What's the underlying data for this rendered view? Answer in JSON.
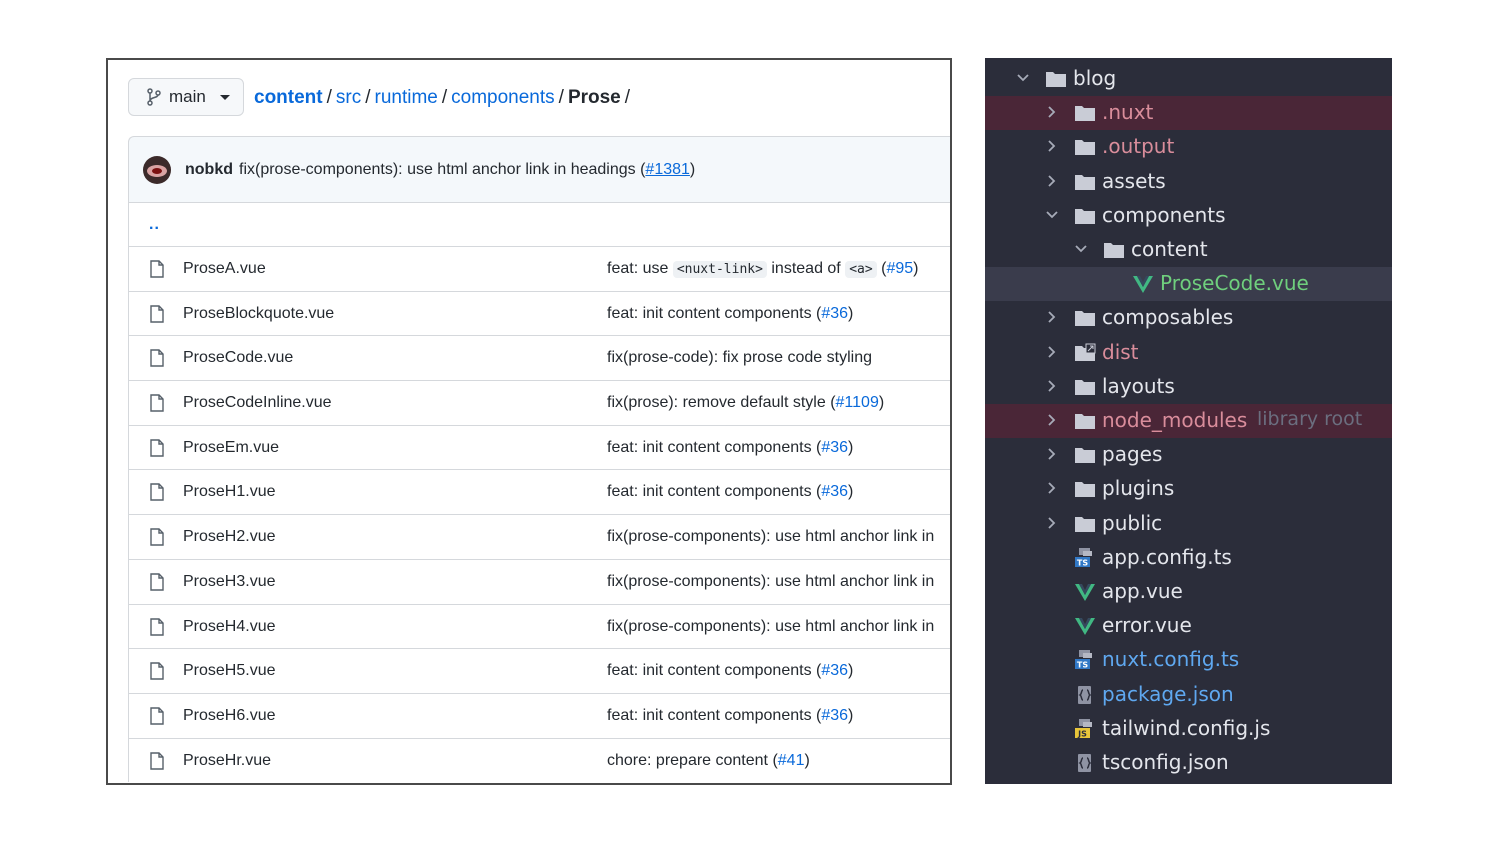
{
  "github": {
    "branch": "main",
    "breadcrumb": {
      "repo": "content",
      "parts": [
        "src",
        "runtime",
        "components"
      ],
      "current": "Prose",
      "trailing_sep": "/"
    },
    "commit": {
      "author": "nobkd",
      "message": "fix(prose-components): use html anchor link in headings (",
      "link": "#1381",
      "close": ")"
    },
    "parent_dir": "..",
    "files": [
      {
        "name": "ProseA.vue",
        "msg_parts": [
          "feat: use ",
          "<nuxt-link>",
          " instead of ",
          "<a>",
          " ("
        ],
        "link": "#95",
        "close": ")"
      },
      {
        "name": "ProseBlockquote.vue",
        "msg": "feat: init content components (",
        "link": "#36",
        "close": ")"
      },
      {
        "name": "ProseCode.vue",
        "msg": "fix(prose-code): fix prose code styling",
        "link": "",
        "close": ""
      },
      {
        "name": "ProseCodeInline.vue",
        "msg": "fix(prose): remove default style (",
        "link": "#1109",
        "close": ")"
      },
      {
        "name": "ProseEm.vue",
        "msg": "feat: init content components (",
        "link": "#36",
        "close": ")"
      },
      {
        "name": "ProseH1.vue",
        "msg": "feat: init content components (",
        "link": "#36",
        "close": ")"
      },
      {
        "name": "ProseH2.vue",
        "msg": "fix(prose-components): use html anchor link in",
        "link": "",
        "close": ""
      },
      {
        "name": "ProseH3.vue",
        "msg": "fix(prose-components): use html anchor link in",
        "link": "",
        "close": ""
      },
      {
        "name": "ProseH4.vue",
        "msg": "fix(prose-components): use html anchor link in",
        "link": "",
        "close": ""
      },
      {
        "name": "ProseH5.vue",
        "msg": "feat: init content components (",
        "link": "#36",
        "close": ")"
      },
      {
        "name": "ProseH6.vue",
        "msg": "feat: init content components (",
        "link": "#36",
        "close": ")"
      },
      {
        "name": "ProseHr.vue",
        "msg": "chore: prepare content (",
        "link": "#41",
        "close": ")"
      }
    ]
  },
  "ide": {
    "tree": [
      {
        "label": "blog",
        "kind": "folder",
        "chevron": "down",
        "level": 0,
        "color": "default",
        "highlight": "none"
      },
      {
        "label": ".nuxt",
        "kind": "folder",
        "chevron": "right",
        "level": 1,
        "color": "red",
        "highlight": "red"
      },
      {
        "label": ".output",
        "kind": "folder",
        "chevron": "right",
        "level": 1,
        "color": "red",
        "highlight": "none"
      },
      {
        "label": "assets",
        "kind": "folder",
        "chevron": "right",
        "level": 1,
        "color": "default",
        "highlight": "none"
      },
      {
        "label": "components",
        "kind": "folder",
        "chevron": "down",
        "level": 1,
        "color": "default",
        "highlight": "none"
      },
      {
        "label": "content",
        "kind": "folder",
        "chevron": "down",
        "level": 2,
        "color": "default",
        "highlight": "none"
      },
      {
        "label": "ProseCode.vue",
        "kind": "vue",
        "chevron": "none",
        "level": 3,
        "color": "green",
        "highlight": "gray"
      },
      {
        "label": "composables",
        "kind": "folder",
        "chevron": "right",
        "level": 1,
        "color": "default",
        "highlight": "none"
      },
      {
        "label": "dist",
        "kind": "folder-link",
        "chevron": "right",
        "level": 1,
        "color": "red",
        "highlight": "none"
      },
      {
        "label": "layouts",
        "kind": "folder",
        "chevron": "right",
        "level": 1,
        "color": "default",
        "highlight": "none"
      },
      {
        "label": "node_modules",
        "note": "library root",
        "kind": "folder",
        "chevron": "right",
        "level": 1,
        "color": "red",
        "highlight": "red"
      },
      {
        "label": "pages",
        "kind": "folder",
        "chevron": "right",
        "level": 1,
        "color": "default",
        "highlight": "none"
      },
      {
        "label": "plugins",
        "kind": "folder",
        "chevron": "right",
        "level": 1,
        "color": "default",
        "highlight": "none"
      },
      {
        "label": "public",
        "kind": "folder",
        "chevron": "right",
        "level": 1,
        "color": "default",
        "highlight": "none"
      },
      {
        "label": "app.config.ts",
        "kind": "ts",
        "chevron": "none",
        "level": 1,
        "color": "default",
        "highlight": "none"
      },
      {
        "label": "app.vue",
        "kind": "vue",
        "chevron": "none",
        "level": 1,
        "color": "default",
        "highlight": "none"
      },
      {
        "label": "error.vue",
        "kind": "vue",
        "chevron": "none",
        "level": 1,
        "color": "default",
        "highlight": "none"
      },
      {
        "label": "nuxt.config.ts",
        "kind": "ts",
        "chevron": "none",
        "level": 1,
        "color": "blue",
        "highlight": "none"
      },
      {
        "label": "package.json",
        "kind": "json",
        "chevron": "none",
        "level": 1,
        "color": "blue",
        "highlight": "none"
      },
      {
        "label": "tailwind.config.js",
        "kind": "js",
        "chevron": "none",
        "level": 1,
        "color": "default",
        "highlight": "none"
      },
      {
        "label": "tsconfig.json",
        "kind": "json",
        "chevron": "none",
        "level": 1,
        "color": "default",
        "highlight": "none"
      }
    ],
    "badges": {
      "ts": "TS",
      "js": "JS"
    }
  }
}
